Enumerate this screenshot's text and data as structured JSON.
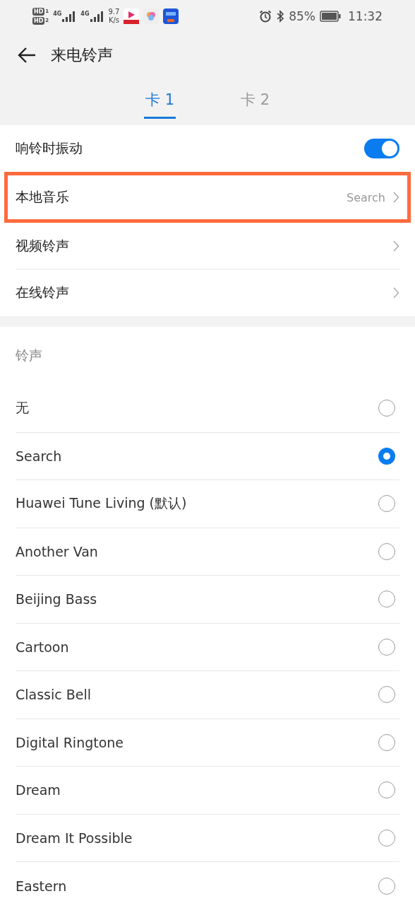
{
  "status_bar": {
    "sims": [
      {
        "badge": "HD",
        "slot": "1"
      },
      {
        "badge": "HD",
        "slot": "2"
      }
    ],
    "networks": [
      "4G",
      "4G"
    ],
    "speed": [
      "9.7",
      "K/s"
    ],
    "battery": "85%",
    "time": "11:32"
  },
  "header": {
    "title": "来电铃声"
  },
  "tabs": [
    {
      "label": "卡 1",
      "selected": true
    },
    {
      "label": "卡 2",
      "selected": false
    }
  ],
  "settings": [
    {
      "kind": "toggle",
      "label": "响铃时振动",
      "on": true
    },
    {
      "kind": "link",
      "label": "本地音乐",
      "value": "Search",
      "highlighted": true
    },
    {
      "kind": "link",
      "label": "视频铃声",
      "highlighted": false
    },
    {
      "kind": "link",
      "label": "在线铃声",
      "highlighted": false
    }
  ],
  "ringtones": {
    "title": "铃声",
    "items": [
      {
        "label": "无",
        "selected": false
      },
      {
        "label": "Search",
        "selected": true
      },
      {
        "label": "Huawei Tune Living (默认)",
        "selected": false
      },
      {
        "label": "Another Van",
        "selected": false
      },
      {
        "label": "Beijing Bass",
        "selected": false
      },
      {
        "label": "Cartoon",
        "selected": false
      },
      {
        "label": "Classic Bell",
        "selected": false
      },
      {
        "label": "Digital Ringtone",
        "selected": false
      },
      {
        "label": "Dream",
        "selected": false
      },
      {
        "label": "Dream It Possible",
        "selected": false
      },
      {
        "label": "Eastern",
        "selected": false
      }
    ]
  }
}
